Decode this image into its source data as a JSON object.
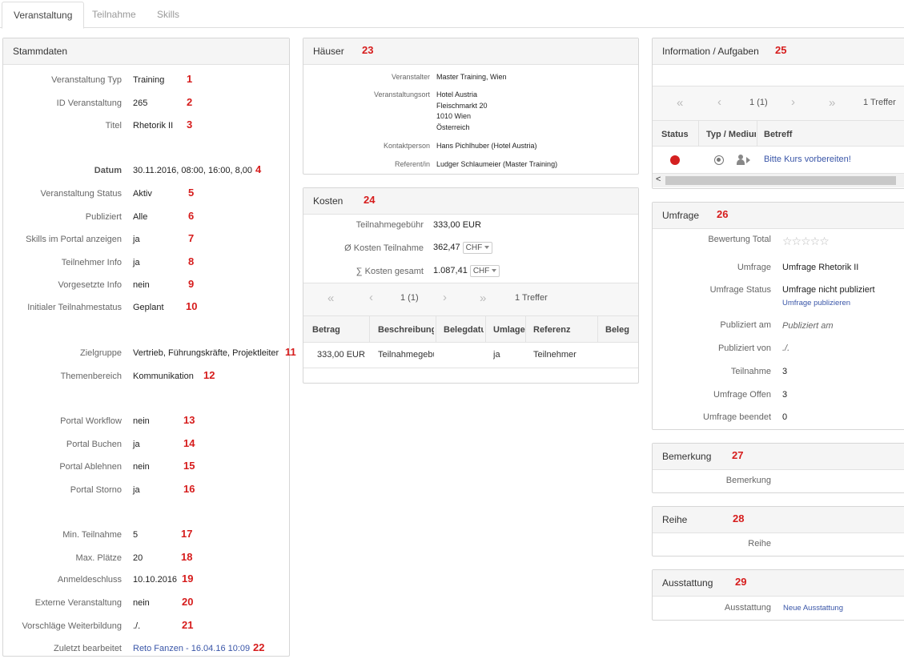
{
  "tabs": [
    "Veranstaltung",
    "Teilnahme",
    "Skills"
  ],
  "stammdaten": {
    "title": "Stammdaten",
    "rows": [
      {
        "label": "Veranstaltung Typ",
        "value": "Training",
        "marker": "1"
      },
      {
        "label": "ID Veranstaltung",
        "value": "265",
        "marker": "2"
      },
      {
        "label": "Titel",
        "value": "Rhetorik II",
        "marker": "3"
      },
      {
        "label": "Datum",
        "value": "30.11.2016, 08:00, 16:00, 8,00",
        "marker": "4"
      },
      {
        "label": "Veranstaltung Status",
        "value": "Aktiv",
        "marker": "5"
      },
      {
        "label": "Publiziert",
        "value": "Alle",
        "marker": "6"
      },
      {
        "label": "Skills im Portal anzeigen",
        "value": "ja",
        "marker": "7"
      },
      {
        "label": "Teilnehmer Info",
        "value": "ja",
        "marker": "8"
      },
      {
        "label": "Vorgesetzte Info",
        "value": "nein",
        "marker": "9"
      },
      {
        "label": "Initialer Teilnahmestatus",
        "value": "Geplant",
        "marker": "10"
      },
      {
        "label": "Zielgruppe",
        "value": "Vertrieb, Führungskräfte, Projektleiter",
        "marker": "11"
      },
      {
        "label": "Themenbereich",
        "value": "Kommunikation",
        "marker": "12"
      },
      {
        "label": "Portal Workflow",
        "value": "nein",
        "marker": "13"
      },
      {
        "label": "Portal Buchen",
        "value": "ja",
        "marker": "14"
      },
      {
        "label": "Portal Ablehnen",
        "value": "nein",
        "marker": "15"
      },
      {
        "label": "Portal Storno",
        "value": "ja",
        "marker": "16"
      },
      {
        "label": "Min. Teilnahme",
        "value": "5",
        "marker": "17"
      },
      {
        "label": "Max. Plätze",
        "value": "20",
        "marker": "18"
      },
      {
        "label": "Anmeldeschluss",
        "value": "10.10.2016",
        "marker": "19"
      },
      {
        "label": "Externe Veranstaltung",
        "value": "nein",
        "marker": "20"
      },
      {
        "label": "Vorschläge Weiterbildung",
        "value": "./.",
        "marker": "21"
      },
      {
        "label": "Zuletzt bearbeitet",
        "value": "Reto Fanzen - 16.04.16 10:09",
        "marker": "22"
      }
    ]
  },
  "haeuser": {
    "title": "Häuser",
    "marker": "23",
    "rows": [
      {
        "label": "Veranstalter",
        "value": "Master Training, Wien"
      },
      {
        "label": "Veranstaltungsort",
        "lines": [
          "Hotel Austria",
          "Fleischmarkt 20",
          "1010 Wien",
          "Österreich"
        ]
      },
      {
        "label": "Kontaktperson",
        "value": "Hans Pichlhuber (Hotel Austria)"
      },
      {
        "label": "Referent/in",
        "value": "Ludger Schlaumeier (Master Training)"
      }
    ]
  },
  "kosten": {
    "title": "Kosten",
    "marker": "24",
    "rows": [
      {
        "label": "Teilnahmegebühr",
        "value": "333,00 EUR"
      },
      {
        "label": "Ø Kosten Teilnahme",
        "value": "362,47",
        "currency": "CHF"
      },
      {
        "label": "∑ Kosten gesamt",
        "value": "1.087,41",
        "currency": "CHF"
      }
    ],
    "pager": {
      "page": "1 (1)",
      "hits": "1 Treffer",
      "first": "«",
      "prev": "‹",
      "next": "›",
      "last": "»"
    },
    "columns": [
      "Betrag",
      "Beschreibung",
      "Belegdatum",
      "Umlage",
      "Referenz",
      "Beleg"
    ],
    "table_rows": [
      [
        "333,00 EUR",
        "Teilnahmegebühr",
        "",
        "ja",
        "Teilnehmer",
        ""
      ]
    ]
  },
  "info": {
    "title": "Information / Aufgaben",
    "marker": "25",
    "pager": {
      "page": "1 (1)",
      "hits": "1 Treffer",
      "first": "«",
      "prev": "‹",
      "next": "›",
      "last": "»"
    },
    "columns": [
      "Status",
      "Typ / Medium",
      "Betreff"
    ],
    "row": {
      "subject": "Bitte Kurs vorbereiten!",
      "status_color": "#d42020"
    },
    "scroll_left": "<"
  },
  "umfrage": {
    "title": "Umfrage",
    "marker": "26",
    "rating_label": "Bewertung Total",
    "stars": "☆☆☆☆☆",
    "rows": [
      {
        "label": "Umfrage",
        "value": "Umfrage Rhetorik II"
      },
      {
        "label": "Umfrage Status",
        "value": "Umfrage nicht publiziert",
        "link": "Umfrage publizieren"
      },
      {
        "label": "Publiziert am",
        "value": "Publiziert am"
      },
      {
        "label": "Publiziert von",
        "value": "./."
      },
      {
        "label": "Teilnahme",
        "value": "3"
      },
      {
        "label": "Umfrage Offen",
        "value": "3"
      },
      {
        "label": "Umfrage beendet",
        "value": "0"
      }
    ]
  },
  "bemerkung": {
    "title": "Bemerkung",
    "marker": "27",
    "label": "Bemerkung"
  },
  "reihe": {
    "title": "Reihe",
    "marker": "28",
    "label": "Reihe"
  },
  "ausstattung": {
    "title": "Ausstattung",
    "marker": "29",
    "label": "Ausstattung",
    "link": "Neue Ausstattung"
  }
}
